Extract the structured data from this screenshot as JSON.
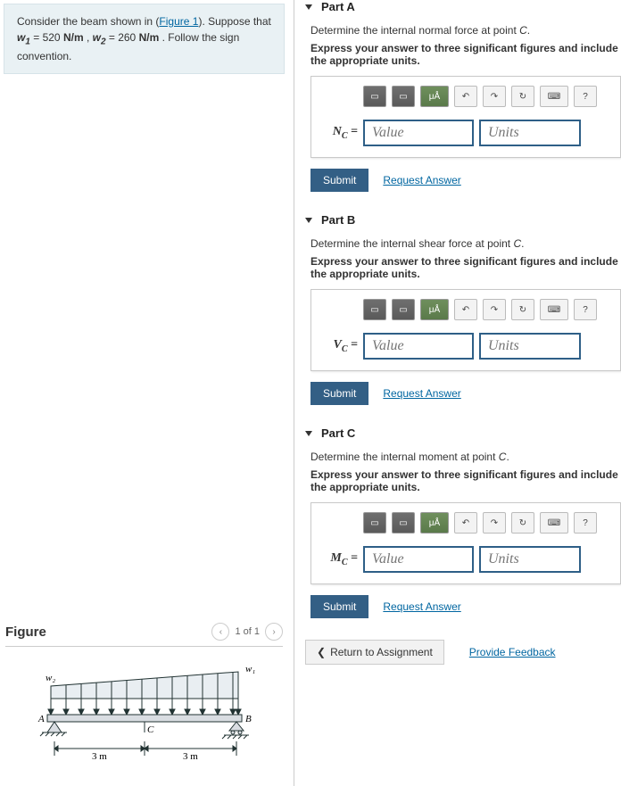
{
  "problem": {
    "prefix": "Consider the beam shown in (",
    "figure_link": "Figure 1",
    "mid": "). Suppose that ",
    "w1_sym": "w",
    "w1_sub": "1",
    "w1_eq": " = 520  ",
    "w1_unit": "N/m",
    "sep": " , ",
    "w2_sym": "w",
    "w2_sub": "2",
    "w2_eq": " = 260  ",
    "w2_unit": "N/m",
    "tail": " . Follow the sign convention."
  },
  "figure": {
    "title": "Figure",
    "pager_prev": "‹",
    "pager_text": "1 of 1",
    "pager_next": "›",
    "labels": {
      "w1": "w₁",
      "w2": "w₂",
      "A": "A",
      "B": "B",
      "C": "C",
      "d1": "3 m",
      "d2": "3 m"
    }
  },
  "parts": [
    {
      "id": "A",
      "title": "Part A",
      "question_pre": "Determine the internal normal force at point ",
      "question_var": "C",
      "question_post": ".",
      "hint": "Express your answer to three significant figures and include the appropriate units.",
      "symbol_main": "N",
      "symbol_sub": "C",
      "value_ph": "Value",
      "units_ph": "Units",
      "submit": "Submit",
      "request": "Request Answer"
    },
    {
      "id": "B",
      "title": "Part B",
      "question_pre": "Determine the internal shear force at point ",
      "question_var": "C",
      "question_post": ".",
      "hint": "Express your answer to three significant figures and include the appropriate units.",
      "symbol_main": "V",
      "symbol_sub": "C",
      "value_ph": "Value",
      "units_ph": "Units",
      "submit": "Submit",
      "request": "Request Answer"
    },
    {
      "id": "C",
      "title": "Part C",
      "question_pre": "Determine the internal moment at point ",
      "question_var": "C",
      "question_post": ".",
      "hint": "Express your answer to three significant figures and include the appropriate units.",
      "symbol_main": "M",
      "symbol_sub": "C",
      "value_ph": "Value",
      "units_ph": "Units",
      "submit": "Submit",
      "request": "Request Answer"
    }
  ],
  "toolbar_labels": {
    "templates": "▭",
    "fraction": "▭",
    "greek": "μÅ",
    "undo": "↶",
    "redo": "↷",
    "reset": "↻",
    "keyboard": "⌨",
    "help": "?"
  },
  "footer": {
    "return_prefix": "❮",
    "return_label": "Return to Assignment",
    "feedback": "Provide Feedback"
  }
}
